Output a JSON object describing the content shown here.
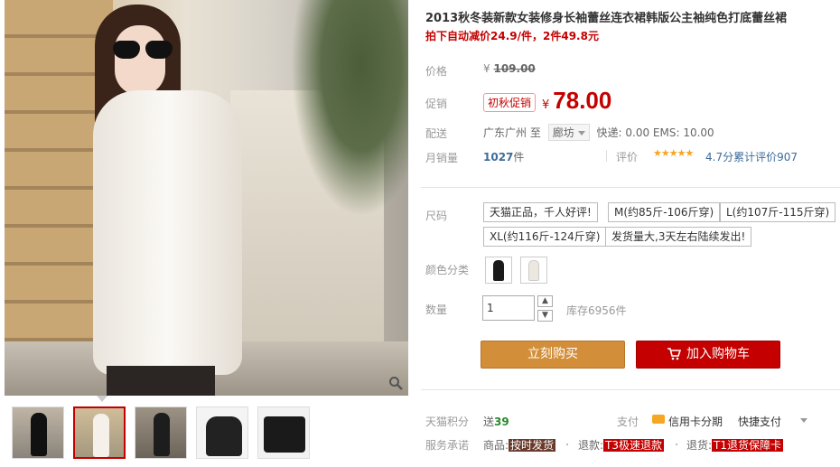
{
  "product": {
    "title": "2013秋冬装新款女装修身长袖蕾丝连衣裙韩版公主袖纯色打底蕾丝裙",
    "promo_line": "拍下自动减价24.9/件，2件49.8元"
  },
  "price": {
    "label": "价格",
    "currency": "¥",
    "original": "109.00",
    "promo_label": "促销",
    "promo_tag": "初秋促销",
    "sale": "78.00"
  },
  "shipping": {
    "label": "配送",
    "from": "广东广州",
    "to_word": "至",
    "dest": "廊坊",
    "fee": "快递: 0.00 EMS: 10.00"
  },
  "sales": {
    "label": "月销量",
    "count": "1027",
    "unit": "件",
    "rating_label": "评价",
    "stars": "★★★★★",
    "rating_text": "4.7分累计评价907"
  },
  "size": {
    "label": "尺码",
    "options": [
      "天猫正品，千人好评!",
      "M(约85斤-106斤穿)",
      "L(约107斤-115斤穿)",
      "XL(约116斤-124斤穿)",
      "发货量大,3天左右陆续发出!"
    ]
  },
  "color": {
    "label": "颜色分类"
  },
  "quantity": {
    "label": "数量",
    "value": "1",
    "up": "▲",
    "down": "▼",
    "stock": "库存6956件"
  },
  "actions": {
    "buy": "立刻购买",
    "cart": "加入购物车"
  },
  "footer": {
    "points_label": "天猫积分",
    "points_prefix": "送",
    "points_value": "39",
    "pay_label": "支付",
    "pay_credit": "信用卡分期",
    "pay_fast": "快捷支付",
    "service_label": "服务承诺",
    "svc1_prefix": "商品:",
    "svc1_tag": "按时发货",
    "svc2_prefix": "退款:",
    "svc2_tag": "T3极速退款",
    "svc3_prefix": "退货:",
    "svc3_tag": "T1退货保障卡"
  },
  "colors": {
    "accent": "#c40000",
    "buy_button": "#d28e39",
    "link": "#3d6b9b"
  }
}
